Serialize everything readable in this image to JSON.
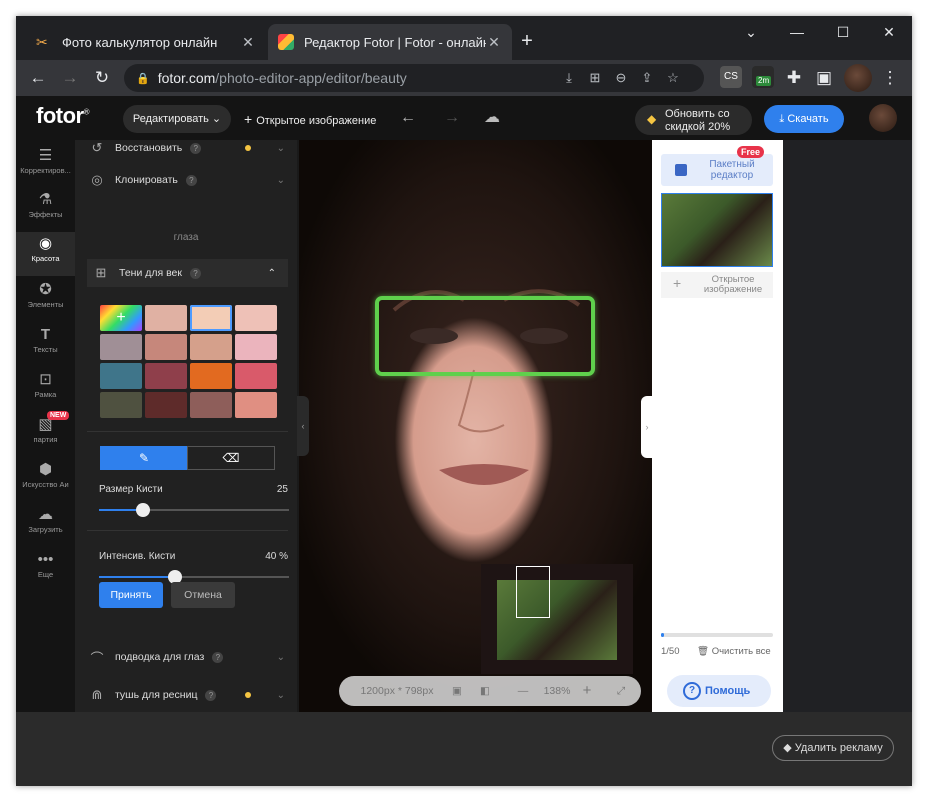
{
  "browser": {
    "tabs": [
      {
        "title": "Фото калькулятор онлайн",
        "close": "✕"
      },
      {
        "title": "Редактор Fotor  |  Fotor - онлайн",
        "close": "✕"
      }
    ],
    "new_tab": "+",
    "window_controls": {
      "dropdown": "⌄",
      "minimize": "—",
      "maximize": "☐",
      "close": "✕"
    },
    "url_domain": "fotor.com",
    "url_path": "/photo-editor-app/editor/beauty",
    "extension_badge": "2m",
    "extension_cs": "CS"
  },
  "header": {
    "logo": "fotor",
    "edit_button": "Редактировать",
    "open_image": "Открытое изображение",
    "promo_line1": "Обновить со",
    "promo_line2": "скидкой 20%",
    "download": "Скачать"
  },
  "rail": [
    {
      "label": "Корректиров...",
      "icon": "sliders-icon"
    },
    {
      "label": "Эффекты",
      "icon": "flask-icon"
    },
    {
      "label": "Красота",
      "icon": "eye-icon"
    },
    {
      "label": "Элементы",
      "icon": "star-icon"
    },
    {
      "label": "Тексты",
      "icon": "text-icon"
    },
    {
      "label": "Рамка",
      "icon": "frame-icon"
    },
    {
      "label": "партия",
      "icon": "batch-icon"
    },
    {
      "label": "Искусство Аи",
      "icon": "ai-icon"
    },
    {
      "label": "Загрузить",
      "icon": "upload-icon"
    },
    {
      "label": "Еще",
      "icon": "more-icon"
    }
  ],
  "rail_new_badge": "NEW",
  "panel": {
    "restore": "Восстановить",
    "clone": "Клонировать",
    "section_eyes": "глаза",
    "eyeshadow": "Тени для век",
    "brush_size_label": "Размер Кисти",
    "brush_size_value": "25",
    "brush_intensity_label": "Интенсив. Кисти",
    "brush_intensity_value": "40 %",
    "apply": "Принять",
    "cancel": "Отмена",
    "eyeliner": "подводка для глаз",
    "mascara": "тушь для ресниц",
    "swatches": [
      "#e0b1a3",
      "#f3cdb6",
      "#eec1b7",
      "#a08f96",
      "#c6877b",
      "#d5a08b",
      "#ebb4bd",
      "#3f758a",
      "#8f3f4b",
      "#e26a20",
      "#d95a6a",
      "#4f5140",
      "#5e2b2a",
      "#8e5e5a",
      "#e08f82"
    ],
    "brush_size_fraction": 0.23,
    "brush_intensity_fraction": 0.4
  },
  "canvas": {
    "size": "1200px * 798px",
    "zoom": "138%"
  },
  "right": {
    "free": "Free",
    "batch_line1": "Пакетный",
    "batch_line2": "редактор",
    "open_line1": "Открытое",
    "open_line2": "изображение",
    "count": "1/50",
    "clear_all": "Очистить все",
    "help": "Помощь"
  },
  "footer": {
    "remove_ads": "Удалить рекламу"
  }
}
